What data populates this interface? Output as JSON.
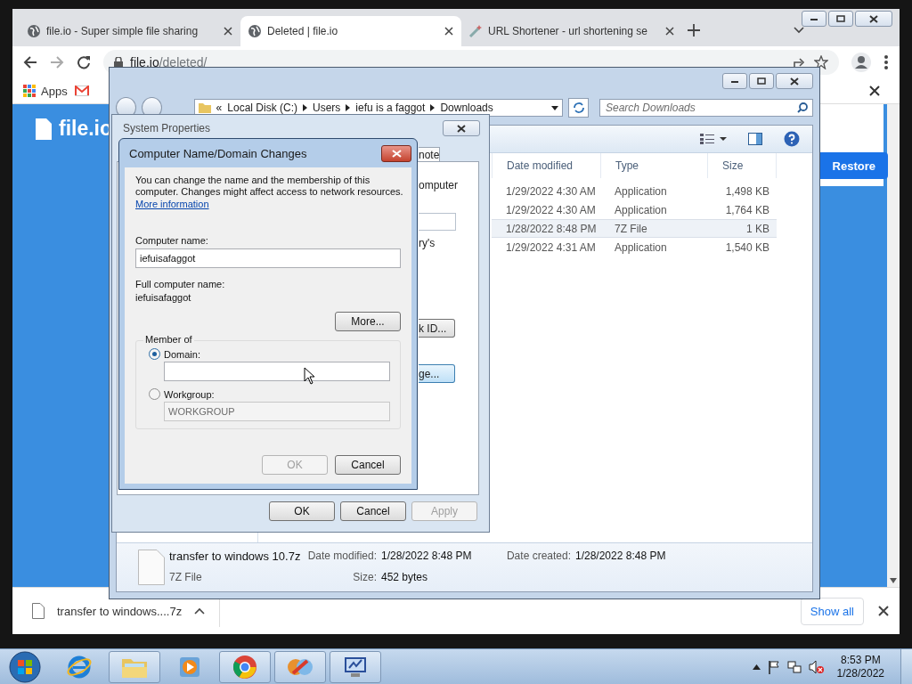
{
  "browser": {
    "tabs": [
      {
        "title": "file.io - Super simple file sharing",
        "selected": false,
        "kind": "globe"
      },
      {
        "title": "Deleted | file.io",
        "selected": true,
        "kind": "globe"
      },
      {
        "title": "URL Shortener - url shortening se",
        "selected": false,
        "kind": "wand"
      }
    ],
    "url_host": "file.io",
    "url_path": "/deleted/",
    "bookmarks": [
      "Apps"
    ],
    "page": {
      "logo": "file.io",
      "restore_button": "Restore"
    },
    "download_shelf": {
      "file": "transfer to windows....7z",
      "show_all": "Show all"
    }
  },
  "explorer": {
    "overflow": "«",
    "breadcrumb": [
      "Local Disk (C:)",
      "Users",
      "iefu is a faggot",
      "Downloads"
    ],
    "search_placeholder": "Search Downloads",
    "columns": [
      "Date modified",
      "Type",
      "Size"
    ],
    "rows": [
      {
        "date": "1/29/2022 4:30 AM",
        "type": "Application",
        "size": "1,498 KB",
        "selected": false
      },
      {
        "date": "1/29/2022 4:30 AM",
        "type": "Application",
        "size": "1,764 KB",
        "selected": false
      },
      {
        "date": "1/28/2022 8:48 PM",
        "type": "7Z File",
        "size": "1 KB",
        "selected": true
      },
      {
        "date": "1/29/2022 4:31 AM",
        "type": "Application",
        "size": "1,540 KB",
        "selected": false
      }
    ],
    "details": {
      "name": "transfer to windows 10.7z",
      "type": "7Z File",
      "modified_label": "Date modified:",
      "modified": "1/28/2022 8:48 PM",
      "size_label": "Size:",
      "size": "452 bytes",
      "created_label": "Date created:",
      "created": "1/28/2022 8:48 PM"
    }
  },
  "system_properties": {
    "title": "System Properties",
    "tab_fragment": "note",
    "text_fragments": [
      "omputer",
      "ry's"
    ],
    "button_fragments": [
      {
        "label": "k ID...",
        "default": false
      },
      {
        "label": "ge...",
        "default": true
      }
    ],
    "buttons": [
      {
        "label": "OK",
        "disabled": false
      },
      {
        "label": "Cancel",
        "disabled": false
      },
      {
        "label": "Apply",
        "disabled": true
      }
    ]
  },
  "name_dialog": {
    "title": "Computer Name/Domain Changes",
    "intro": "You can change the name and the membership of this computer. Changes might affect access to network resources.",
    "link": "More information",
    "computer_name_label": "Computer name:",
    "computer_name": "iefuisafaggot",
    "full_name_label": "Full computer name:",
    "full_name": "iefuisafaggot",
    "more_button": "More...",
    "member_of": "Member of",
    "options": [
      {
        "label": "Domain:",
        "selected": true
      },
      {
        "label": "Workgroup:",
        "selected": false,
        "value": "WORKGROUP"
      }
    ],
    "buttons": [
      {
        "label": "OK",
        "disabled": true
      },
      {
        "label": "Cancel",
        "disabled": false
      }
    ]
  },
  "taskbar": {
    "apps": [
      {
        "kind": "ie",
        "open": false
      },
      {
        "kind": "folder",
        "open": true
      },
      {
        "kind": "media",
        "open": false
      },
      {
        "kind": "chrome",
        "open": true
      },
      {
        "kind": "app",
        "open": true
      },
      {
        "kind": "monitor",
        "open": true
      }
    ],
    "clock_time": "8:53 PM",
    "clock_date": "1/28/2022"
  }
}
